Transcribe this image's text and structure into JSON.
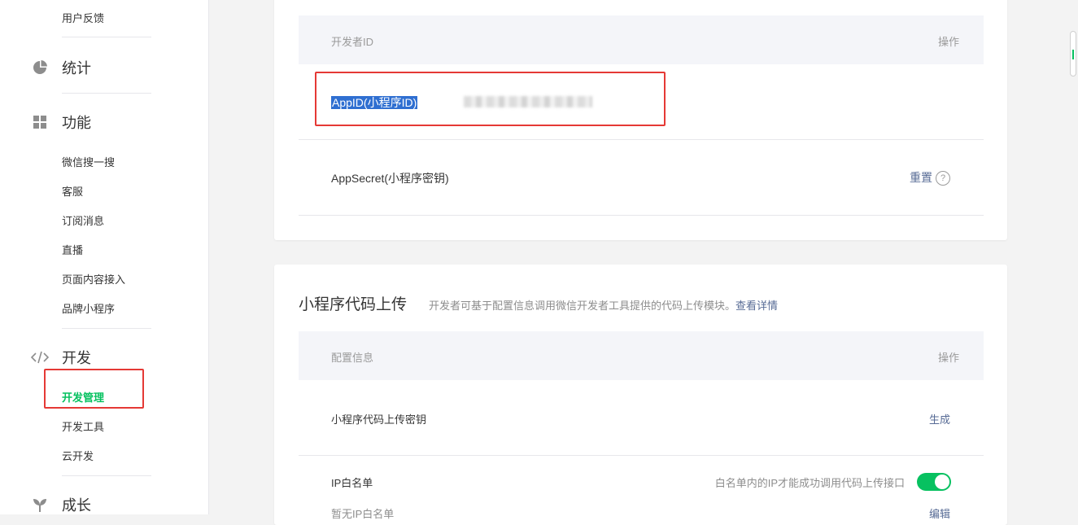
{
  "sidebar": {
    "feedback": "用户反馈",
    "stats": {
      "label": "统计",
      "icon": "pie-chart-icon"
    },
    "features": {
      "label": "功能",
      "icon": "grid-icon"
    },
    "feature_items": [
      "微信搜一搜",
      "客服",
      "订阅消息",
      "直播",
      "页面内容接入",
      "品牌小程序"
    ],
    "develop": {
      "label": "开发",
      "icon": "code-icon"
    },
    "develop_items": [
      "开发管理",
      "开发工具",
      "云开发"
    ],
    "growth": {
      "label": "成长",
      "icon": "sprout-icon"
    }
  },
  "devid": {
    "header_left": "开发者ID",
    "header_right": "操作",
    "appid_label": "AppID(小程序ID)",
    "appsecret_label": "AppSecret(小程序密钥)",
    "reset_label": "重置",
    "help_icon": "question-circle-icon"
  },
  "upload": {
    "title": "小程序代码上传",
    "desc": "开发者可基于配置信息调用微信开发者工具提供的代码上传模块。",
    "detail_link": "查看详情",
    "header_left": "配置信息",
    "header_right": "操作",
    "key_label": "小程序代码上传密钥",
    "generate_label": "生成",
    "ip_label": "IP白名单",
    "ip_hint": "白名单内的IP才能成功调用代码上传接口",
    "ip_toggle_on": true,
    "ip_empty": "暂无IP白名单",
    "edit_label": "编辑"
  },
  "colors": {
    "accent": "#07c160",
    "link": "#576b95",
    "highlight": "#e53935"
  }
}
